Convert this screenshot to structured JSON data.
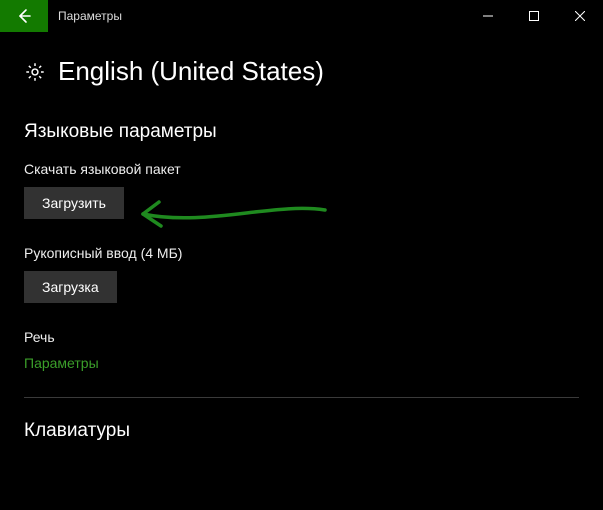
{
  "titlebar": {
    "title": "Параметры"
  },
  "page": {
    "title": "English (United States)"
  },
  "sections": {
    "language_params": {
      "header": "Языковые параметры",
      "download_pack": {
        "label": "Скачать языковой пакет",
        "button": "Загрузить"
      },
      "handwriting": {
        "label": "Рукописный ввод (4 МБ)",
        "button": "Загрузка"
      },
      "speech": {
        "label": "Речь",
        "link": "Параметры"
      }
    },
    "keyboards": {
      "header": "Клавиатуры"
    }
  }
}
